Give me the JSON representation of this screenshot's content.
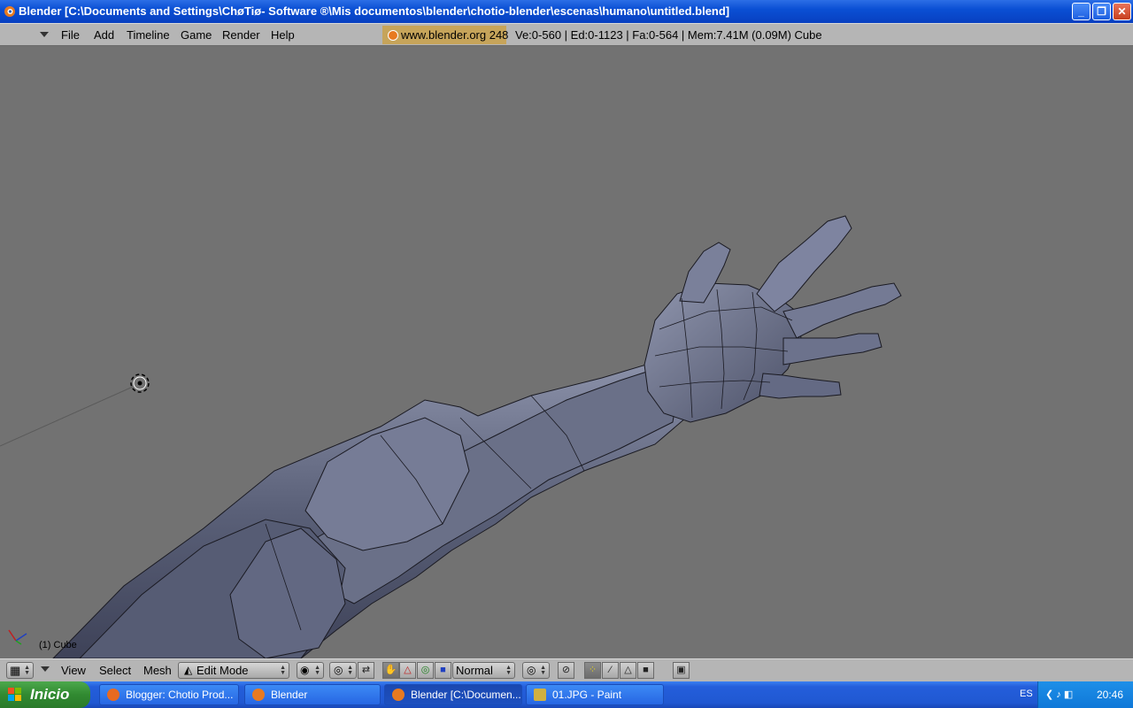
{
  "window": {
    "title": "Blender [C:\\Documents and Settings\\ChøTiø- Software ®\\Mis documentos\\blender\\chotio-blender\\escenas\\humano\\untitled.blend]",
    "minimize": "_",
    "maximize": "❐",
    "close": "✕"
  },
  "menubar": {
    "items": [
      "File",
      "Add",
      "Timeline",
      "Game",
      "Render",
      "Help"
    ],
    "logo_text": "www.blender.org 248",
    "stats": "Ve:0-560 | Ed:0-1123 | Fa:0-564 | Mem:7.41M (0.09M) Cube"
  },
  "viewport": {
    "object_label": "(1) Cube"
  },
  "bottom_header": {
    "view_label": "View",
    "select_label": "Select",
    "mesh_label": "Mesh",
    "mode_label": "Edit Mode",
    "orientation_label": "Normal"
  },
  "taskbar": {
    "start_label": "Inicio",
    "tasks": [
      {
        "label": "Blogger: Chotio Prod..."
      },
      {
        "label": "Blender"
      },
      {
        "label": "Blender [C:\\Documen..."
      },
      {
        "label": "01.JPG - Paint"
      }
    ],
    "language": "ES",
    "clock": "20:46"
  },
  "colors": {
    "titlebar": "#0a4fd4",
    "viewport_bg": "#727272",
    "header_bg": "#b5b5b5",
    "mesh": "#5c6278"
  }
}
